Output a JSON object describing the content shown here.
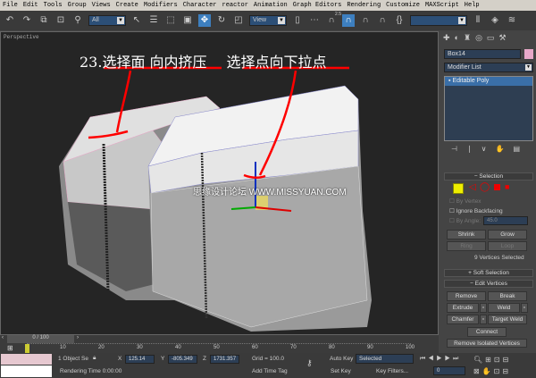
{
  "menu": [
    "File",
    "Edit",
    "Tools",
    "Group",
    "Views",
    "Create",
    "Modifiers",
    "Character",
    "reactor",
    "Animation",
    "Graph Editors",
    "Rendering",
    "Customize",
    "MAXScript",
    "Help"
  ],
  "toolbar": {
    "selection_filter": "All",
    "reference_coord": "View",
    "snap_value": "2.5"
  },
  "viewport": {
    "label": "Perspective",
    "annotation_step": "23.",
    "annotation_1": "选择面 向内挤压",
    "annotation_2": "选择点向下拉点",
    "watermark": "思缘设计论坛 WWW.MISSYUAN.COM"
  },
  "panel": {
    "object_name": "Box14",
    "object_color": "#e8a8c8",
    "modifier_list": "Modifier List",
    "stack_item": "Editable Poly",
    "selection": {
      "title": "Selection",
      "by_vertex": "By Vertex",
      "ignore_backfacing": "Ignore Backfacing",
      "by_angle": "By Angle:",
      "angle": "45.0",
      "shrink": "Shrink",
      "grow": "Grow",
      "ring": "Ring",
      "loop": "Loop",
      "status": "9 Vertices Selected"
    },
    "soft_selection": "Soft Selection",
    "edit_vertices": {
      "title": "Edit Vertices",
      "remove": "Remove",
      "break": "Break",
      "extrude": "Extrude",
      "weld": "Weld",
      "chamfer": "Chamfer",
      "target_weld": "Target Weld",
      "connect": "Connect",
      "remove_isolated": "Remove Isolated Vertices"
    }
  },
  "timeline": {
    "frame": "0 / 100",
    "ticks": [
      "10",
      "20",
      "30",
      "40",
      "50",
      "60",
      "70",
      "80",
      "90",
      "100"
    ],
    "current": 0.0
  },
  "status": {
    "selected": "1 Object Se",
    "x": "125.14",
    "y": "-805.349",
    "z": "1731.357",
    "grid": "Grid = 100.0",
    "rendering_time": "Rendering Time  0:00:00",
    "add_time_tag": "Add Time Tag",
    "auto_key": "Auto Key",
    "key_mode": "Selected",
    "set_key": "Set Key",
    "key_filters": "Key Filters...",
    "current_frame": "0"
  }
}
